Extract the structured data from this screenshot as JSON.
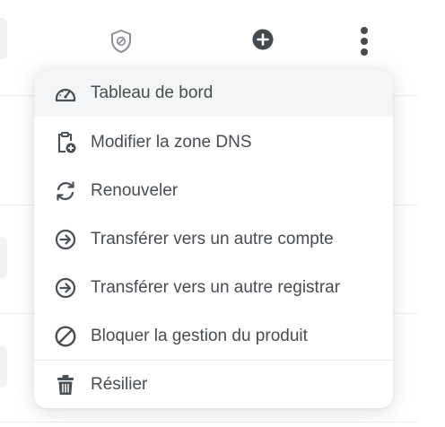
{
  "toolbar": {
    "icons": [
      "shield-slash-icon",
      "plus-circle-icon",
      "more-vertical-icon"
    ]
  },
  "menu": {
    "items": [
      {
        "label": "Tableau de bord",
        "icon": "speedometer-icon"
      },
      {
        "label": "Modifier la zone DNS",
        "icon": "clipboard-plus-icon"
      },
      {
        "label": "Renouveler",
        "icon": "refresh-icon"
      },
      {
        "label": "Transférer vers un autre compte",
        "icon": "arrow-right-circle-icon"
      },
      {
        "label": "Transférer vers un autre registrar",
        "icon": "arrow-right-circle-icon"
      },
      {
        "label": "Bloquer la gestion du produit",
        "icon": "block-icon"
      },
      {
        "label": "Résilier",
        "icon": "trash-icon"
      }
    ]
  },
  "colors": {
    "icon": "#4a4f55",
    "text": "#474c52",
    "active_bg": "#f4f5f6",
    "divider": "#ebedef"
  }
}
